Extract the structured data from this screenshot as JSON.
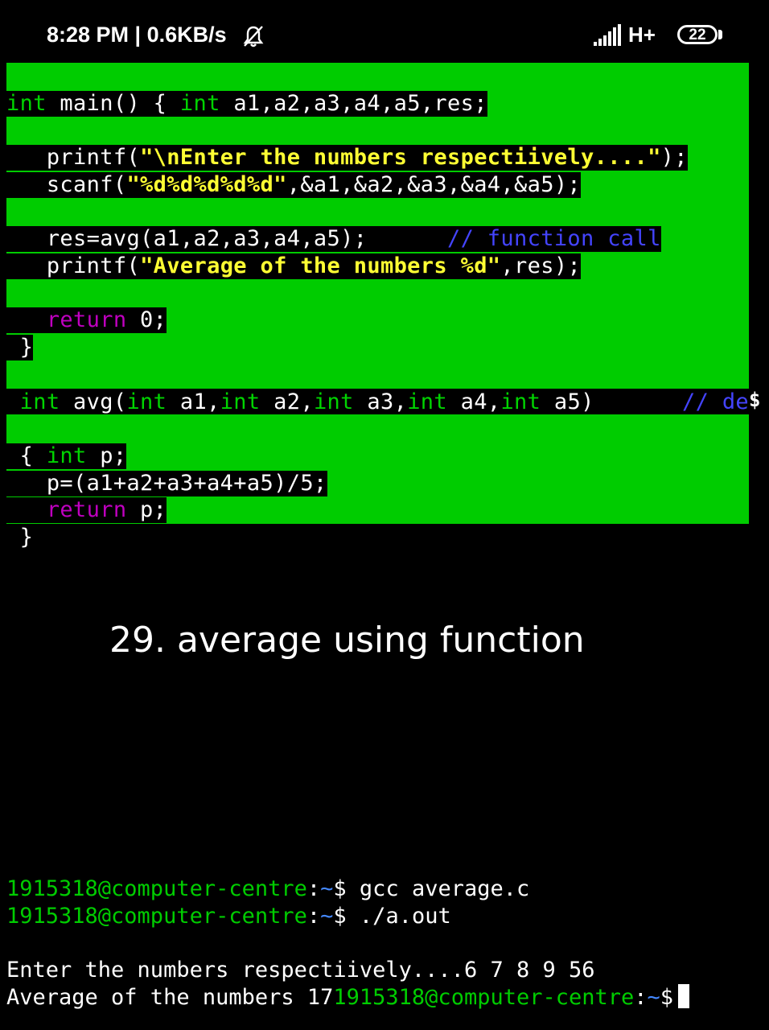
{
  "status_bar": {
    "time_speed": "8:28 PM | 0.6KB/s",
    "network": "H+",
    "battery": "22"
  },
  "code": {
    "line1": {
      "kw": "int",
      "text": " main() { ",
      "kw2": "int",
      "text2": " a1,a2,a3,a4,a5,res;"
    },
    "line2": {
      "pre": "   printf(",
      "str": "\"\\nEnter the numbers respectiively....\"",
      "post": ");"
    },
    "line3": {
      "pre": "   scanf(",
      "str": "\"%d%d%d%d%d\"",
      "post": ",&a1,&a2,&a3,&a4,&a5);"
    },
    "line4": {
      "pre": "   res=avg(a1,a2,a3,a4,a5);      ",
      "comment": "// function call"
    },
    "line5": {
      "pre": "   printf(",
      "str": "\"Average of the numbers %d\"",
      "post": ",res);"
    },
    "line6": {
      "kw": "   return",
      "post": " 0;"
    },
    "line7": " }",
    "line8": {
      "kw1": " int",
      "t1": " avg(",
      "kw2": "int",
      "t2": " a1,",
      "kw3": "int",
      "t3": " a2,",
      "kw4": "int",
      "t4": " a3,",
      "kw5": "int",
      "t5": " a4,",
      "kw6": "int",
      "t6": " a5)",
      "comment": "// de"
    },
    "line9": {
      "pre": " { ",
      "kw": "int",
      "post": " p;"
    },
    "line10": "   p=(a1+a2+a3+a4+a5)/5;",
    "line11": {
      "kw": "   return",
      "post": " p;"
    },
    "line12": " }",
    "eol_marker": "$"
  },
  "caption": "29. average using function",
  "terminal": {
    "prompt_user": "1915318@computer-centre",
    "prompt_path": "~",
    "prompt_symbol": "$",
    "cmd1": " gcc average.c",
    "cmd2": " ./a.out",
    "output1": "Enter the numbers respectiively....6 7 8 9 56",
    "output2": "Average of the numbers 17",
    "last_user": "1915318@computer-centre",
    "last_path": "~",
    "last_symbol": "$"
  }
}
